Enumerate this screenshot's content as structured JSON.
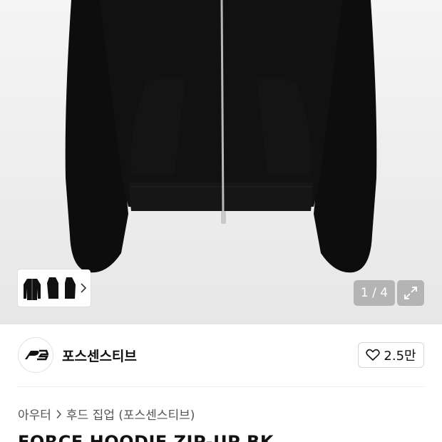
{
  "gallery": {
    "counter_text": "1 / 4",
    "thumbnail_count": 3,
    "background": "#ececec"
  },
  "brand": {
    "name": "포스센스티브",
    "logo_text": "PS",
    "likes_label": "2.5만"
  },
  "breadcrumb": {
    "category": "아우터",
    "subcategory": "후드 집업 (포스센스티브)"
  },
  "product": {
    "title": "FORCE HOODIE ZIP-UP BK"
  },
  "icons": {
    "thumb_next": "chevron-right-icon",
    "expand": "expand-icon",
    "like": "heart-outline-icon",
    "breadcrumb_sep": "chevron-right-icon"
  }
}
